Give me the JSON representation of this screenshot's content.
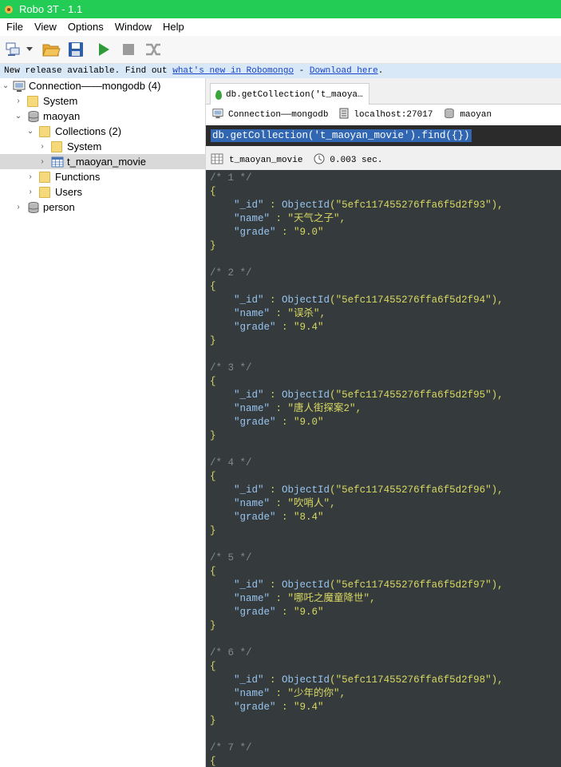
{
  "window": {
    "title": "Robo 3T - 1.1"
  },
  "menu": {
    "items": [
      "File",
      "View",
      "Options",
      "Window",
      "Help"
    ]
  },
  "notice": {
    "prefix": "New release available. Find out ",
    "link1": "what's new in Robomongo",
    "sep": " - ",
    "link2": "Download here",
    "suffix": "."
  },
  "tree": {
    "connection": "Connection——mongodb (4)",
    "system": "System",
    "maoyan": "maoyan",
    "collections": "Collections (2)",
    "coll_system": "System",
    "coll_movie": "t_maoyan_movie",
    "functions": "Functions",
    "users": "Users",
    "person": "person"
  },
  "tab": {
    "label": "db.getCollection('t_maoya…"
  },
  "conn": {
    "connection": "Connection——mongodb",
    "host": "localhost:27017",
    "db": "maoyan"
  },
  "query": "db.getCollection('t_maoyan_movie').find({})",
  "result": {
    "collection": "t_maoyan_movie",
    "time": "0.003 sec."
  },
  "documents": [
    {
      "num": "/* 1 */",
      "oid": "5efc117455276ffa6f5d2f93",
      "name": "天气之子",
      "grade": "9.0"
    },
    {
      "num": "/* 2 */",
      "oid": "5efc117455276ffa6f5d2f94",
      "name": "误杀",
      "grade": "9.4"
    },
    {
      "num": "/* 3 */",
      "oid": "5efc117455276ffa6f5d2f95",
      "name": "唐人街探案2",
      "grade": "9.0"
    },
    {
      "num": "/* 4 */",
      "oid": "5efc117455276ffa6f5d2f96",
      "name": "吹哨人",
      "grade": "8.4"
    },
    {
      "num": "/* 5 */",
      "oid": "5efc117455276ffa6f5d2f97",
      "name": "哪吒之魔童降世",
      "grade": "9.6"
    },
    {
      "num": "/* 6 */",
      "oid": "5efc117455276ffa6f5d2f98",
      "name": "少年的你",
      "grade": "9.4"
    },
    {
      "num": "/* 7 */"
    }
  ],
  "keys": {
    "id": "\"_id\"",
    "name": "\"name\"",
    "grade": "\"grade\""
  },
  "colors": {
    "titlebar": "#22cc55",
    "results_bg": "#353a3d",
    "selection": "#3166b3"
  }
}
